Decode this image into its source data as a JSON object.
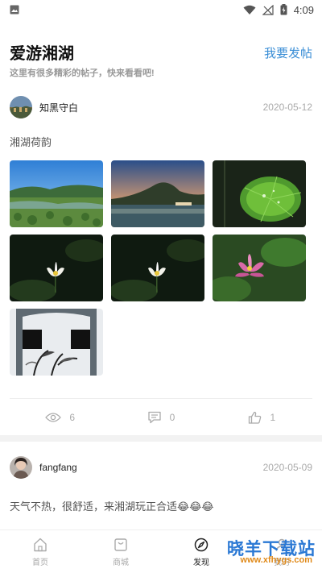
{
  "status_bar": {
    "time": "4:09"
  },
  "header": {
    "title": "爱游湘湖",
    "subtitle": "这里有很多精彩的帖子，快来看看吧!",
    "post_button": "我要发帖"
  },
  "posts": [
    {
      "author": "知黑守白",
      "date": "2020-05-12",
      "text": "湘湖荷韵",
      "images": [
        "lake-landscape",
        "mountain-lake-dusk",
        "lotus-leaf-droplets",
        "white-lotus",
        "white-lotus",
        "pink-lotus",
        "ink-painting"
      ],
      "views": "6",
      "comments": "0",
      "likes": "1"
    },
    {
      "author": "fangfang",
      "date": "2020-05-09",
      "text": "天气不热，很舒适，来湘湖玩正合适😂😂😂"
    }
  ],
  "nav": {
    "items": [
      {
        "label": "首页",
        "icon": "home-icon"
      },
      {
        "label": "商城",
        "icon": "shop-icon"
      },
      {
        "label": "发现",
        "icon": "discover-icon"
      },
      {
        "label": "我的",
        "icon": "profile-icon"
      }
    ],
    "active": "发现"
  },
  "watermark": {
    "main": "晓羊下载站",
    "url": "www.xfhygs.com"
  },
  "colors": {
    "accent": "#3a8ed6",
    "watermark_blue": "#2a78d4",
    "watermark_orange": "#e08a1a"
  }
}
